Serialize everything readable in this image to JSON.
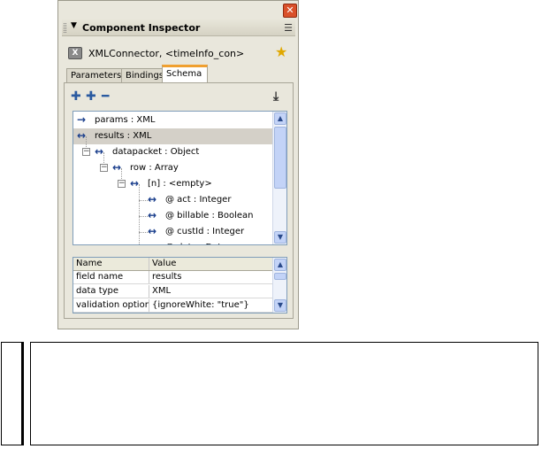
{
  "panel": {
    "close_glyph": "✕",
    "title": "Component Inspector",
    "collapse_glyph": "▼",
    "options_glyph": "☰",
    "component_label": "XMLConnector, <timeInfo_con>"
  },
  "tabs": [
    {
      "label": "Parameters",
      "active": false
    },
    {
      "label": "Bindings",
      "active": false
    },
    {
      "label": "Schema",
      "active": true
    }
  ],
  "toolbar": {
    "add_field_glyph": "✚",
    "add_child_glyph": "✚",
    "remove_glyph": "━",
    "import_glyph": "⤓"
  },
  "tree": [
    {
      "label": "params : XML",
      "arrow": "→",
      "depth": 0,
      "expander": "",
      "selected": false
    },
    {
      "label": "results : XML",
      "arrow": "↔",
      "depth": 0,
      "expander": "",
      "selected": true
    },
    {
      "label": "datapacket : Object",
      "arrow": "↔",
      "depth": 1,
      "expander": "−",
      "selected": false
    },
    {
      "label": "row : Array",
      "arrow": "↔",
      "depth": 2,
      "expander": "−",
      "selected": false
    },
    {
      "label": "[n] : <empty>",
      "arrow": "↔",
      "depth": 3,
      "expander": "−",
      "selected": false
    },
    {
      "label": "@ act : Integer",
      "arrow": "↔",
      "depth": 4,
      "expander": "",
      "selected": false
    },
    {
      "label": "@ billable : Boolean",
      "arrow": "↔",
      "depth": 4,
      "expander": "",
      "selected": false
    },
    {
      "label": "@ custId : Integer",
      "arrow": "↔",
      "depth": 4,
      "expander": "",
      "selected": false
    },
    {
      "label": "@ date : Date",
      "arrow": "↔",
      "depth": 4,
      "expander": "",
      "selected": false
    }
  ],
  "grid": {
    "columns": [
      "Name",
      "Value"
    ],
    "rows": [
      {
        "name": "field name",
        "value": "results"
      },
      {
        "name": "data type",
        "value": "XML"
      },
      {
        "name": "validation options",
        "value": "{ignoreWhite: \"true\"}"
      }
    ]
  },
  "scroll": {
    "up_glyph": "▲",
    "down_glyph": "▼"
  },
  "colors": {
    "tab_accent": "#f0a030",
    "arrow": "#1a3e8c",
    "selection": "#d4d0c8"
  }
}
